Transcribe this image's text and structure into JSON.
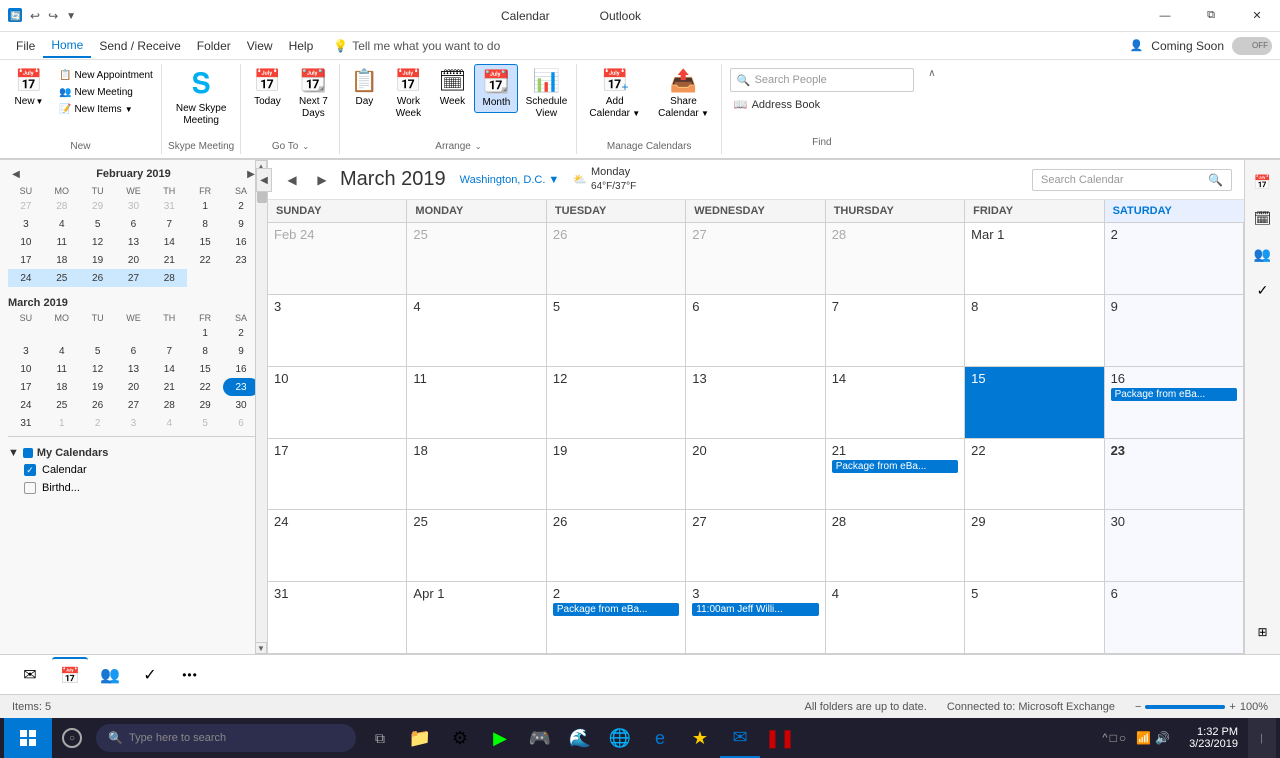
{
  "window": {
    "title_left": "Calendar",
    "title_right": "Outlook",
    "controls": {
      "minimize": "—",
      "maximize": "❐",
      "restore": "⧉",
      "close": "✕"
    }
  },
  "menu": {
    "items": [
      "File",
      "Home",
      "Send / Receive",
      "Folder",
      "View",
      "Help"
    ],
    "active": "Home",
    "tell_me": "Tell me what you want to do",
    "coming_soon": "Coming Soon",
    "toggle": "OFF"
  },
  "ribbon": {
    "new_group": {
      "label": "New",
      "new_appointment": "New\nAppointment",
      "new_meeting": "New\nMeeting",
      "new_items": "New\nItems"
    },
    "skype_group": {
      "label": "Skype Meeting",
      "new_skype": "New Skype\nMeeting"
    },
    "goto_group": {
      "label": "Go To",
      "today": "Today",
      "next7": "Next 7\nDays"
    },
    "arrange_group": {
      "label": "Arrange",
      "day": "Day",
      "work_week": "Work\nWeek",
      "week": "Week",
      "month": "Month",
      "schedule_view": "Schedule\nView"
    },
    "manage_group": {
      "label": "Manage Calendars",
      "add_calendar": "Add\nCalendar",
      "share_calendar": "Share\nCalendar"
    },
    "find_group": {
      "label": "Find",
      "search_people_placeholder": "Search People",
      "address_book": "Address Book"
    }
  },
  "mini_calendars": {
    "february": {
      "title": "February 2019",
      "days_header": [
        "SU",
        "MO",
        "TU",
        "WE",
        "TH",
        "FR",
        "SA"
      ],
      "weeks": [
        [
          "27",
          "28",
          "29",
          "30",
          "31",
          "1",
          "2"
        ],
        [
          "3",
          "4",
          "5",
          "6",
          "7",
          "8",
          "9"
        ],
        [
          "10",
          "11",
          "12",
          "13",
          "14",
          "15",
          "16"
        ],
        [
          "17",
          "18",
          "19",
          "20",
          "21",
          "22",
          "23"
        ],
        [
          "24",
          "25",
          "26",
          "27",
          "28",
          "",
          ""
        ]
      ],
      "other_month_indices": [
        [
          0,
          0
        ],
        [
          0,
          1
        ],
        [
          0,
          2
        ],
        [
          0,
          3
        ],
        [
          0,
          4
        ]
      ]
    },
    "march": {
      "title": "March 2019",
      "days_header": [
        "SU",
        "MO",
        "TU",
        "WE",
        "TH",
        "FR",
        "SA"
      ],
      "weeks": [
        [
          "",
          "",
          "",
          "",
          "",
          "1",
          "2"
        ],
        [
          "3",
          "4",
          "5",
          "6",
          "7",
          "8",
          "9"
        ],
        [
          "10",
          "11",
          "12",
          "13",
          "14",
          "15",
          "16"
        ],
        [
          "17",
          "18",
          "19",
          "20",
          "21",
          "22",
          "23"
        ],
        [
          "24",
          "25",
          "26",
          "27",
          "28",
          "29",
          "30"
        ],
        [
          "31",
          "1",
          "2",
          "3",
          "4",
          "5",
          "6"
        ]
      ],
      "today": "23",
      "today_week_index": 3,
      "today_day_index": 6
    }
  },
  "my_calendars": {
    "title": "My Calendars",
    "items": [
      {
        "label": "Calendar",
        "checked": true,
        "color": "#0078d4"
      },
      {
        "label": "Birthd...",
        "checked": false,
        "color": "#107c10"
      }
    ]
  },
  "calendar_header": {
    "month_title": "March 2019",
    "location": "Washington, D.C.",
    "weather_icon": "☁",
    "weather": "Monday\n64°F/37°F",
    "search_placeholder": "Search Calendar"
  },
  "month_grid": {
    "headers": [
      "SUNDAY",
      "MONDAY",
      "TUESDAY",
      "WEDNESDAY",
      "THURSDAY",
      "FRIDAY",
      "SATURDAY"
    ],
    "weeks": [
      {
        "days": [
          {
            "date": "Feb 24",
            "events": [],
            "other": true
          },
          {
            "date": "25",
            "events": [],
            "other": true
          },
          {
            "date": "26",
            "events": [],
            "other": true
          },
          {
            "date": "27",
            "events": [],
            "other": true
          },
          {
            "date": "28",
            "events": [],
            "other": true
          },
          {
            "date": "Mar 1",
            "events": [],
            "other": false
          },
          {
            "date": "2",
            "events": [],
            "other": false,
            "sat": true
          }
        ]
      },
      {
        "days": [
          {
            "date": "3",
            "events": []
          },
          {
            "date": "4",
            "events": []
          },
          {
            "date": "5",
            "events": []
          },
          {
            "date": "6",
            "events": []
          },
          {
            "date": "7",
            "events": []
          },
          {
            "date": "8",
            "events": []
          },
          {
            "date": "9",
            "events": [],
            "sat": true
          }
        ]
      },
      {
        "days": [
          {
            "date": "10",
            "events": []
          },
          {
            "date": "11",
            "events": []
          },
          {
            "date": "12",
            "events": []
          },
          {
            "date": "13",
            "events": []
          },
          {
            "date": "14",
            "events": []
          },
          {
            "date": "15",
            "events": [],
            "today": true,
            "selected": true
          },
          {
            "date": "16",
            "events": [
              {
                "label": "Package from eBa...",
                "type": "blue"
              }
            ],
            "sat": true
          }
        ]
      },
      {
        "days": [
          {
            "date": "17",
            "events": []
          },
          {
            "date": "18",
            "events": []
          },
          {
            "date": "19",
            "events": []
          },
          {
            "date": "20",
            "events": []
          },
          {
            "date": "21",
            "events": [
              {
                "label": "Package from eBa...",
                "type": "blue"
              }
            ]
          },
          {
            "date": "22",
            "events": []
          },
          {
            "date": "23",
            "events": [],
            "sat": true,
            "bold": true
          }
        ]
      },
      {
        "days": [
          {
            "date": "24",
            "events": []
          },
          {
            "date": "25",
            "events": []
          },
          {
            "date": "26",
            "events": []
          },
          {
            "date": "27",
            "events": []
          },
          {
            "date": "28",
            "events": []
          },
          {
            "date": "29",
            "events": []
          },
          {
            "date": "30",
            "events": [],
            "sat": true
          }
        ]
      },
      {
        "days": [
          {
            "date": "31",
            "events": []
          },
          {
            "date": "Apr 1",
            "events": []
          },
          {
            "date": "2",
            "events": [
              {
                "label": "Package from eBa...",
                "type": "blue"
              }
            ]
          },
          {
            "date": "3",
            "events": [
              {
                "label": "11:00am Jeff Willi...",
                "type": "blue"
              }
            ]
          },
          {
            "date": "4",
            "events": []
          },
          {
            "date": "5",
            "events": []
          },
          {
            "date": "6",
            "events": [],
            "sat": true
          }
        ]
      }
    ]
  },
  "right_sidebar": {
    "icons": [
      "📅",
      "🗓",
      "👥",
      "✓",
      "⊞"
    ]
  },
  "bottom_nav": {
    "mail_icon": "✉",
    "calendar_icon": "📅",
    "people_icon": "👥",
    "tasks_icon": "✓",
    "more_icon": "•••"
  },
  "status_bar": {
    "items_count": "Items: 5",
    "sync_status": "All folders are up to date.",
    "connection": "Connected to: Microsoft Exchange",
    "zoom": "100%"
  },
  "taskbar": {
    "search_placeholder": "Type here to search",
    "time": "1:32 PM",
    "date": "3/23/2019"
  }
}
